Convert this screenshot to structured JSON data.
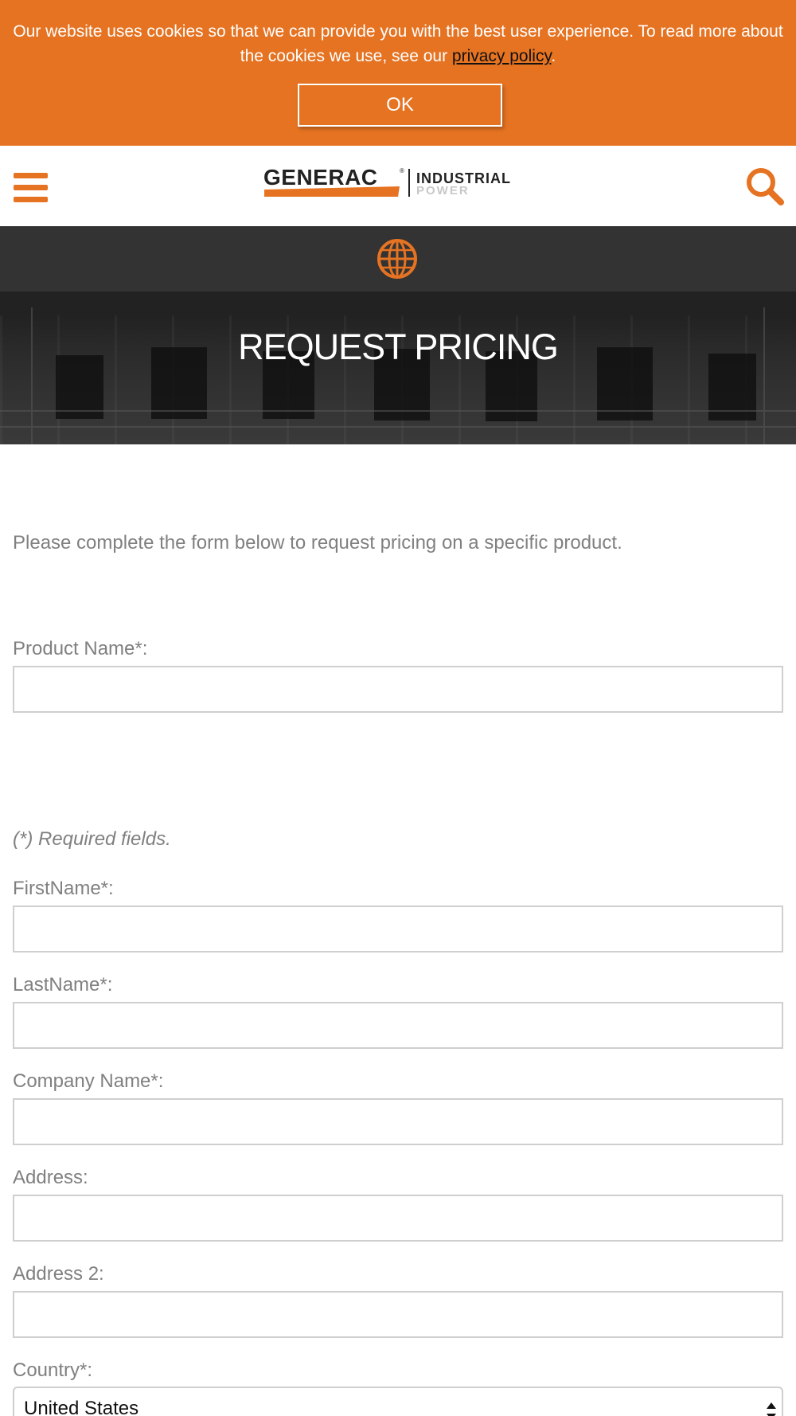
{
  "cookie_banner": {
    "text_before": "Our website uses cookies so that we can provide you with the best user experience. To read more about the cookies we use, see our ",
    "link_text": "privacy policy",
    "text_after": ".",
    "ok_label": "OK"
  },
  "header": {
    "logo": {
      "brand": "GENERAC",
      "mark": "®",
      "line1": "INDUSTRIAL",
      "line2": "POWER"
    },
    "menu_icon": "hamburger-menu-icon",
    "search_icon": "search-icon",
    "globe_icon": "globe-icon"
  },
  "hero": {
    "title": "REQUEST PRICING"
  },
  "form": {
    "intro": "Please complete the form below to request pricing on a specific product.",
    "product_name_label": "Product Name*:",
    "required_note": "(*) Required fields.",
    "first_name_label": "FirstName*:",
    "last_name_label": "LastName*:",
    "company_label": "Company Name*:",
    "address_label": "Address:",
    "address2_label": "Address 2:",
    "country_label": "Country*:",
    "country_value": "United States"
  },
  "colors": {
    "accent": "#e57322",
    "dark_bar": "#333333",
    "text_gray": "#808080",
    "border": "#cfcfcf"
  }
}
